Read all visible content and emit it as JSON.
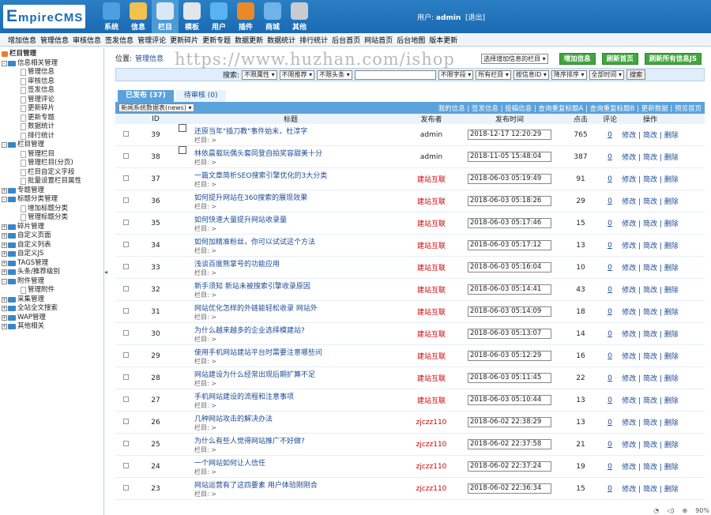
{
  "logo": {
    "big": "E",
    "rest": "mpireCMS"
  },
  "nav": [
    {
      "label": "系统",
      "icon": "system-icon",
      "color": "#4aa0e0",
      "active": false
    },
    {
      "label": "信息",
      "icon": "document-icon",
      "color": "#f2c14e",
      "active": false
    },
    {
      "label": "栏目",
      "icon": "folder-icon",
      "color": "#d9e8f5",
      "active": true
    },
    {
      "label": "模板",
      "icon": "template-icon",
      "color": "#e0e6ec",
      "active": false
    },
    {
      "label": "用户",
      "icon": "user-icon",
      "color": "#59b3f0",
      "active": false
    },
    {
      "label": "插件",
      "icon": "plugin-icon",
      "color": "#e88a2a",
      "active": false
    },
    {
      "label": "商城",
      "icon": "shop-icon",
      "color": "#6fb3e8",
      "active": false
    },
    {
      "label": "其他",
      "icon": "gear-icon",
      "color": "#c8ccd2",
      "active": false
    }
  ],
  "user": {
    "prefix": "用户:",
    "name": "admin",
    "logout": "[退出]"
  },
  "menu": [
    "增加信息",
    "管理信息",
    "审核信息",
    "签发信息",
    "管理评论",
    "更新碎片",
    "更新专题",
    "数据更新",
    "数据统计",
    "排行统计",
    "后台首页",
    "网站首页",
    "后台地图",
    "版本更新"
  ],
  "tree": [
    {
      "label": "栏目管理",
      "level": 0,
      "type": "root",
      "bold": true
    },
    {
      "label": "信息相关管理",
      "level": 1,
      "type": "folder",
      "pm": "-"
    },
    {
      "label": "管理信息",
      "level": 2
    },
    {
      "label": "审核信息",
      "level": 2
    },
    {
      "label": "签发信息",
      "level": 2
    },
    {
      "label": "管理评论",
      "level": 2
    },
    {
      "label": "更新碎片",
      "level": 2
    },
    {
      "label": "更新专题",
      "level": 2
    },
    {
      "label": "数据统计",
      "level": 2
    },
    {
      "label": "排行统计",
      "level": 2
    },
    {
      "label": "栏目管理",
      "level": 1,
      "type": "folder",
      "pm": "-"
    },
    {
      "label": "管理栏目",
      "level": 2
    },
    {
      "label": "管理栏目(分页)",
      "level": 2
    },
    {
      "label": "栏目自定义字段",
      "level": 2
    },
    {
      "label": "批量设置栏目属性",
      "level": 2
    },
    {
      "label": "专题管理",
      "level": 1,
      "type": "folder",
      "pm": "+"
    },
    {
      "label": "标题分类管理",
      "level": 1,
      "type": "folder",
      "pm": "-"
    },
    {
      "label": "增加标题分类",
      "level": 2
    },
    {
      "label": "管理标题分类",
      "level": 2
    },
    {
      "label": "碎片管理",
      "level": 1,
      "type": "folder",
      "pm": "+"
    },
    {
      "label": "自定义页面",
      "level": 1,
      "type": "folder",
      "pm": "+"
    },
    {
      "label": "自定义列表",
      "level": 1,
      "type": "folder",
      "pm": "+"
    },
    {
      "label": "自定义JS",
      "level": 1,
      "type": "folder",
      "pm": "+"
    },
    {
      "label": "TAGS管理",
      "level": 1,
      "type": "folder",
      "pm": "+"
    },
    {
      "label": "头条/推荐级别",
      "level": 1,
      "type": "folder",
      "pm": "+"
    },
    {
      "label": "附件管理",
      "level": 1,
      "type": "folder",
      "pm": "-"
    },
    {
      "label": "管理附件",
      "level": 2
    },
    {
      "label": "采集管理",
      "level": 1,
      "type": "folder",
      "pm": "+"
    },
    {
      "label": "全站全文搜索",
      "level": 1,
      "type": "folder",
      "pm": "+"
    },
    {
      "label": "WAP管理",
      "level": 1,
      "type": "folder",
      "pm": "+"
    },
    {
      "label": "其他相关",
      "level": 1,
      "type": "folder",
      "pm": "+"
    }
  ],
  "location": {
    "label": "位置:",
    "link": "管理信息"
  },
  "watermark": "https://www.huzhan.com/ishop",
  "top_select": "选择增加信息的栏目",
  "buttons": [
    "增加信息",
    "刷新首页",
    "刷新所有信息JS"
  ],
  "search": {
    "label": "搜索:",
    "selects": [
      "不限属性",
      "不限推荐",
      "不限头条"
    ],
    "selects2": [
      "不限字段",
      "所有栏目",
      "按信息ID",
      "降序排序",
      "全部时间"
    ],
    "button": "搜索"
  },
  "tabs": [
    {
      "label": "已发布 (37)",
      "active": true
    },
    {
      "label": "待审核 (0)",
      "active": false
    }
  ],
  "table_select": "新闻系统数据表(news)",
  "bar_links": "我的信息 | 签发信息 | 投稿信息 | 查询重复标题A | 查询重复标题B | 更新数据 | 预览首页",
  "columns": [
    "ID",
    "标题",
    "发布者",
    "发布时间",
    "点击",
    "评论",
    "操作"
  ],
  "row_cat": "栏目: >",
  "row_ops": "修改 | 简改 | 删除",
  "rows": [
    {
      "id": "39",
      "title": "还原当年\"插刀教\"事件始末，杜淳字",
      "pub": "admin",
      "time": "2018-12-17 12:20:29",
      "hits": "765",
      "cmt": "0",
      "pic": true,
      "pubcolor": "blk"
    },
    {
      "id": "38",
      "title": "林依晨载玩偶头套同登自拍奖容甜美十分",
      "pub": "admin",
      "time": "2018-11-05 15:48:04",
      "hits": "387",
      "cmt": "0",
      "pic": true,
      "pubcolor": "blk"
    },
    {
      "id": "37",
      "title": "一篇文章简析SEO搜索引擎优化的3大分类",
      "pub": "建站互联",
      "time": "2018-06-03 05:19:49",
      "hits": "91",
      "cmt": "0",
      "pic": false,
      "pubcolor": "red"
    },
    {
      "id": "36",
      "title": "如何提升网站在360搜索的展现效果",
      "pub": "建站互联",
      "time": "2018-06-03 05:18:26",
      "hits": "29",
      "cmt": "0",
      "pic": false,
      "pubcolor": "red"
    },
    {
      "id": "35",
      "title": "如何快速大量提升网站收录量",
      "pub": "建站互联",
      "time": "2018-06-03 05:17:46",
      "hits": "15",
      "cmt": "0",
      "pic": false,
      "pubcolor": "red"
    },
    {
      "id": "34",
      "title": "如何加精准粉丝，你可以试试这个方法",
      "pub": "建站互联",
      "time": "2018-06-03 05:17:12",
      "hits": "13",
      "cmt": "0",
      "pic": false,
      "pubcolor": "red"
    },
    {
      "id": "33",
      "title": "浅谈百度熊掌号的功能应用",
      "pub": "建站互联",
      "time": "2018-06-03 05:16:04",
      "hits": "10",
      "cmt": "0",
      "pic": false,
      "pubcolor": "red"
    },
    {
      "id": "32",
      "title": "新手须知 新站未被搜索引擎收录原因",
      "pub": "建站互联",
      "time": "2018-06-03 05:14:41",
      "hits": "43",
      "cmt": "0",
      "pic": false,
      "pubcolor": "red"
    },
    {
      "id": "31",
      "title": "网站优化怎样的外链能轻松收录 网站外",
      "pub": "建站互联",
      "time": "2018-06-03 05:14:09",
      "hits": "18",
      "cmt": "0",
      "pic": false,
      "pubcolor": "red"
    },
    {
      "id": "30",
      "title": "为什么越来越多的企业选择模建站?",
      "pub": "建站互联",
      "time": "2018-06-03 05:13:07",
      "hits": "14",
      "cmt": "0",
      "pic": false,
      "pubcolor": "red"
    },
    {
      "id": "29",
      "title": "使用手机网站建站平台时需要注意哪些问",
      "pub": "建站互联",
      "time": "2018-06-03 05:12:29",
      "hits": "16",
      "cmt": "0",
      "pic": false,
      "pubcolor": "red"
    },
    {
      "id": "28",
      "title": "网站建设为什么经常出现后期扩算不足",
      "pub": "建站互联",
      "time": "2018-06-03 05:11:45",
      "hits": "22",
      "cmt": "0",
      "pic": false,
      "pubcolor": "red"
    },
    {
      "id": "27",
      "title": "手机网站建设的流程和注意事项",
      "pub": "建站互联",
      "time": "2018-06-03 05:10:44",
      "hits": "13",
      "cmt": "0",
      "pic": false,
      "pubcolor": "red"
    },
    {
      "id": "26",
      "title": "几种网站攻击的解决办法",
      "pub": "zjczz110",
      "time": "2018-06-02 22:38:29",
      "hits": "13",
      "cmt": "0",
      "pic": false,
      "pubcolor": "red"
    },
    {
      "id": "25",
      "title": "为什么有些人觉得网站推广不好做?",
      "pub": "zjczz110",
      "time": "2018-06-02 22:37:58",
      "hits": "21",
      "cmt": "0",
      "pic": false,
      "pubcolor": "red"
    },
    {
      "id": "24",
      "title": "一个网站如何让人信任",
      "pub": "zjczz110",
      "time": "2018-06-02 22:37:24",
      "hits": "19",
      "cmt": "0",
      "pic": false,
      "pubcolor": "red"
    },
    {
      "id": "23",
      "title": "网站运营有了这四要素 用户体验刚刚合",
      "pub": "zjczz110",
      "time": "2018-06-02 22:36:34",
      "hits": "15",
      "cmt": "0",
      "pic": false,
      "pubcolor": "red"
    }
  ],
  "zoom": "90%"
}
